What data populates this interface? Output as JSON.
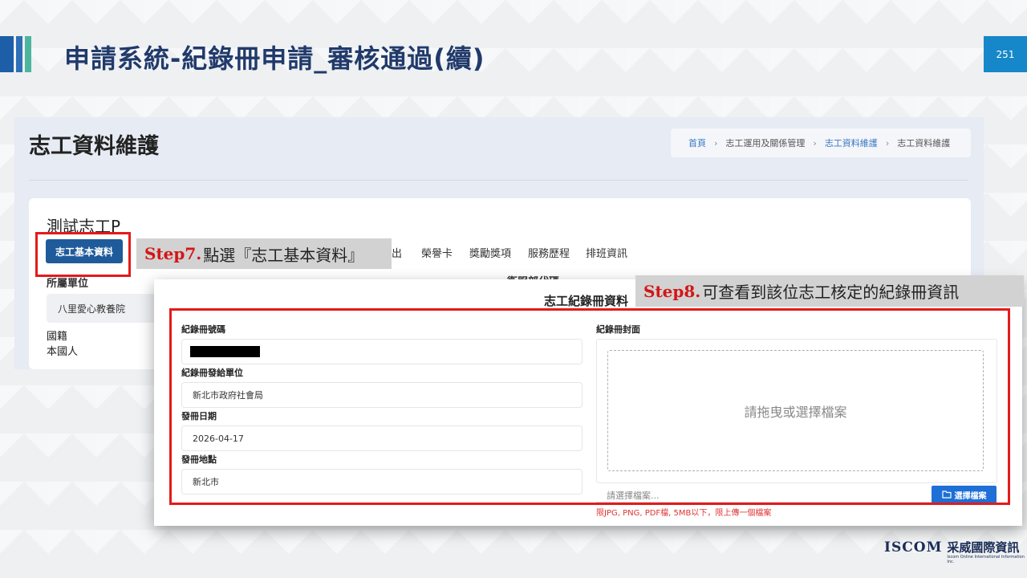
{
  "slide": {
    "title": "申請系統-紀錄冊申請_審核通過(續)",
    "page_number": "251"
  },
  "app": {
    "page_title": "志工資料維護",
    "breadcrumb": [
      "首頁",
      "志工運用及關係管理",
      "志工資料維護",
      "志工資料維護"
    ],
    "volunteer_name": "測試志工P",
    "basic_info_button": "志工基本資料",
    "tabs": [
      "出",
      "榮譽卡",
      "獎勵獎項",
      "服務歷程",
      "排班資訊"
    ],
    "org_label": "所屬單位",
    "org_value": "八里愛心教養院",
    "nationality_label": "國籍",
    "nationality_value": "本國人",
    "right_label_partial": "衛服部代碼"
  },
  "modal": {
    "title": "志工紀錄冊資料",
    "fields": {
      "record_no_label": "紀錄冊號碼",
      "issuer_label": "紀錄冊發給單位",
      "issuer_value": "新北市政府社會局",
      "issue_date_label": "發冊日期",
      "issue_date_value": "2026-04-17",
      "issue_place_label": "發冊地點",
      "issue_place_value": "新北市"
    },
    "cover": {
      "label": "紀錄冊封面",
      "dropzone_text": "請拖曳或選擇檔案",
      "file_placeholder": "請選擇檔案...",
      "select_button": "選擇檔案",
      "hint": "限JPG, PNG, PDF檔, 5MB以下，限上傳一個檔案"
    }
  },
  "annotations": {
    "step7_label": "Step7.",
    "step7_text": "點選『志工基本資料』",
    "step8_label": "Step8.",
    "step8_text": "可查看到該位志工核定的紀錄冊資訊"
  },
  "logo": {
    "en": "ISCOM",
    "zh": "采威國際資訊",
    "sub": "Iscom Online International Information Inc."
  }
}
